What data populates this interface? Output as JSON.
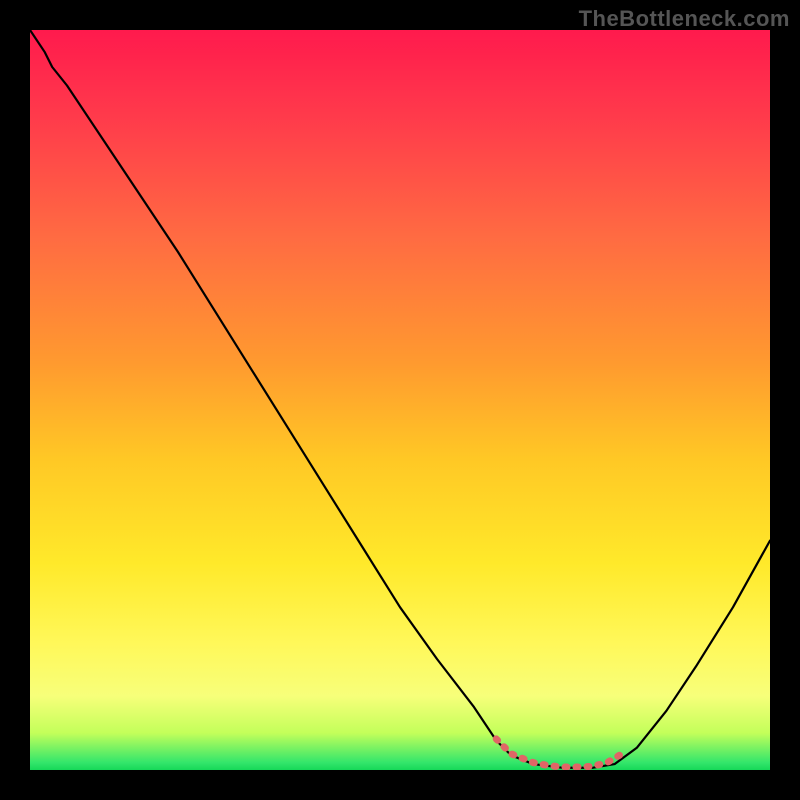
{
  "watermark": "TheBottleneck.com",
  "chart_data": {
    "type": "line",
    "title": "",
    "xlabel": "",
    "ylabel": "",
    "xlim": [
      0,
      100
    ],
    "ylim": [
      0,
      100
    ],
    "gradient_stops": [
      {
        "offset": 0,
        "color": "#ff1a4d"
      },
      {
        "offset": 12,
        "color": "#ff3b4b"
      },
      {
        "offset": 28,
        "color": "#ff6b42"
      },
      {
        "offset": 45,
        "color": "#ff9a2f"
      },
      {
        "offset": 58,
        "color": "#ffc825"
      },
      {
        "offset": 72,
        "color": "#ffe92a"
      },
      {
        "offset": 83,
        "color": "#fff85a"
      },
      {
        "offset": 90,
        "color": "#f7ff7a"
      },
      {
        "offset": 95,
        "color": "#c3ff5a"
      },
      {
        "offset": 99,
        "color": "#33e66b"
      },
      {
        "offset": 100,
        "color": "#16d858"
      }
    ],
    "series": [
      {
        "name": "bottleneck-curve",
        "color": "#000000",
        "stroke_width": 2.2,
        "x": [
          0,
          2,
          3,
          5,
          10,
          15,
          20,
          25,
          30,
          35,
          40,
          45,
          50,
          55,
          60,
          63,
          65,
          68,
          72,
          76,
          79,
          82,
          86,
          90,
          95,
          100
        ],
        "y": [
          100,
          97,
          95,
          92.5,
          85,
          77.5,
          70,
          62,
          54,
          46,
          38,
          30,
          22,
          15,
          8.5,
          4,
          2,
          0.8,
          0.3,
          0.3,
          0.8,
          3,
          8,
          14,
          22,
          31
        ]
      },
      {
        "name": "optimal-flat-highlight",
        "color": "#e06666",
        "stroke_width": 7,
        "dash": "2 9",
        "x": [
          63,
          65,
          68,
          70,
          72,
          74,
          76,
          78,
          80
        ],
        "y": [
          4.2,
          2.2,
          1.0,
          0.6,
          0.4,
          0.4,
          0.5,
          1.0,
          2.2
        ]
      }
    ],
    "annotations": []
  }
}
